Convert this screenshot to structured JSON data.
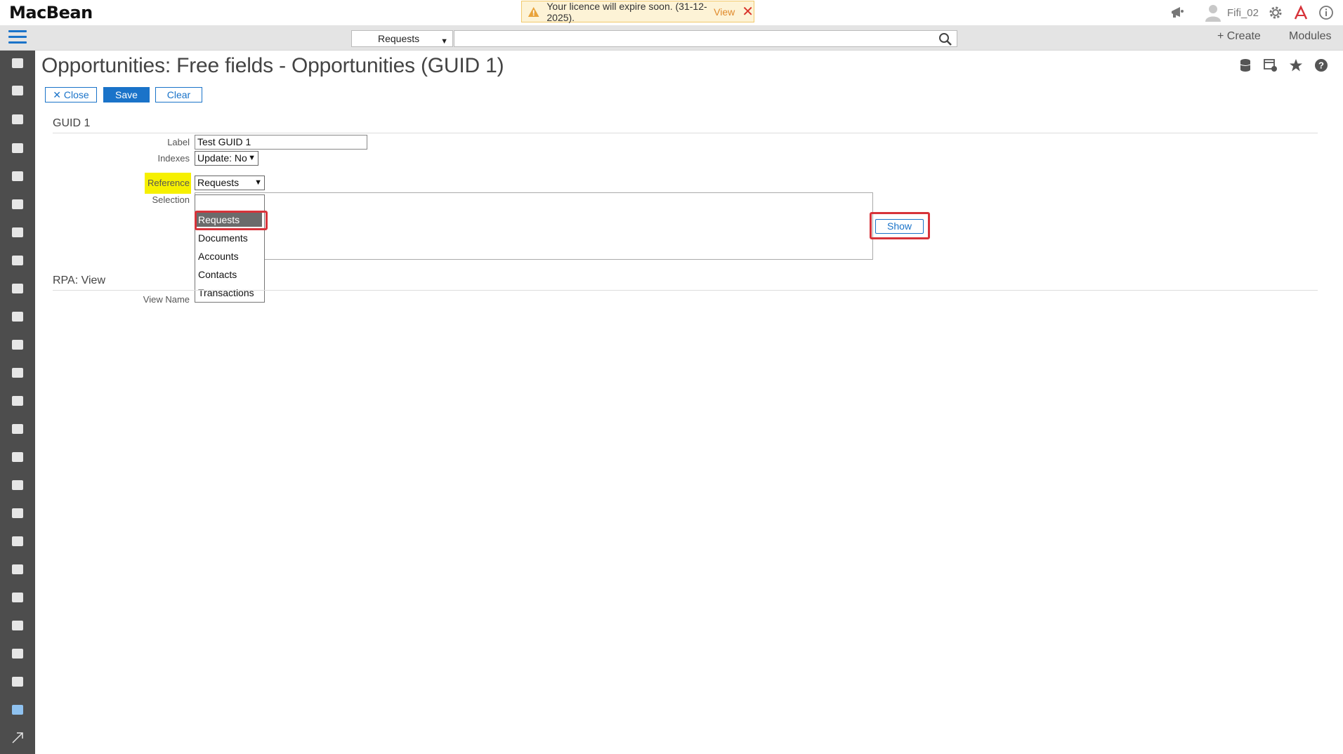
{
  "app": {
    "logo": "MacBean"
  },
  "notice": {
    "text": "Your licence will expire soon. (31-12-2025).",
    "link": "View"
  },
  "user": {
    "name": "Fifi_02"
  },
  "search": {
    "scope": "Requests",
    "query": ""
  },
  "topnav": {
    "create": "+ Create",
    "modules": "Modules"
  },
  "page": {
    "title": "Opportunities: Free fields - Opportunities (GUID 1)"
  },
  "toolbar": {
    "close": "✕ Close",
    "save": "Save",
    "clear": "Clear"
  },
  "section1": {
    "title": "GUID 1",
    "label_caption": "Label",
    "label_value": "Test GUID 1",
    "indexes_caption": "Indexes",
    "indexes_value": "Update: No",
    "reference_caption": "Reference",
    "reference_value": "Requests",
    "selection_caption": "Selection",
    "show_button": "Show"
  },
  "dropdown": {
    "options": [
      "Requests",
      "Documents",
      "Accounts",
      "Contacts",
      "Transactions"
    ],
    "selected": "Requests"
  },
  "section2": {
    "title": "RPA: View",
    "view_name_caption": "View Name"
  },
  "colors": {
    "accent": "#1a73c9",
    "sidebar": "#4d4d4d",
    "highlight": "#f6f000",
    "annotation": "#d7333a"
  }
}
